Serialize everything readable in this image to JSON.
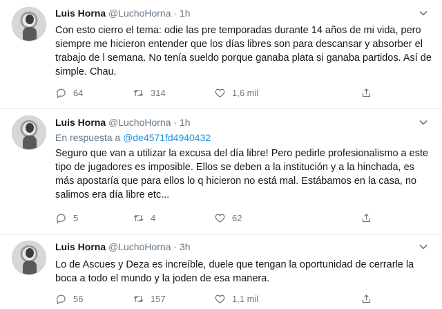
{
  "tweets": [
    {
      "name": "Luis Horna",
      "handle": "@LuchoHorna",
      "dot": "·",
      "time": "1h",
      "reply_label": "",
      "reply_mention": "",
      "text": "Con esto cierro el tema: odie las pre temporadas durante 14 años de mi vida, pero siempre me hicieron entender que los días libres son para descansar y absorber el trabajo de l semana. No tenía sueldo porque ganaba plata si ganaba partidos. Así de simple. Chau.",
      "replies": "64",
      "retweets": "314",
      "likes": "1,6 mil"
    },
    {
      "name": "Luis Horna",
      "handle": "@LuchoHorna",
      "dot": "·",
      "time": "1h",
      "reply_label": "En respuesta a ",
      "reply_mention": "@de4571fd4940432",
      "text": "Seguro que van a utilizar la excusa del día libre! Pero pedirle profesionalismo a este tipo de jugadores es imposible. Ellos se deben a la institución y a la hinchada, es más apostaría que para ellos lo q hicieron no está mal. Estábamos en la casa, no salimos era día libre etc...",
      "replies": "5",
      "retweets": "4",
      "likes": "62"
    },
    {
      "name": "Luis Horna",
      "handle": "@LuchoHorna",
      "dot": "·",
      "time": "3h",
      "reply_label": "",
      "reply_mention": "",
      "text": "Lo de Ascues y Deza es increíble, duele que tengan la oportunidad de cerrarle la boca a todo el mundo y la joden de esa manera.",
      "replies": "56",
      "retweets": "157",
      "likes": "1,1 mil"
    }
  ],
  "icons": {
    "reply": "comment-icon",
    "retweet": "retweet-icon",
    "like": "heart-icon",
    "share": "share-icon",
    "more": "chevron-down-icon"
  },
  "colors": {
    "text": "#14171a",
    "muted": "#657786",
    "link": "#1b95e0",
    "divider": "#e6ecf0"
  }
}
